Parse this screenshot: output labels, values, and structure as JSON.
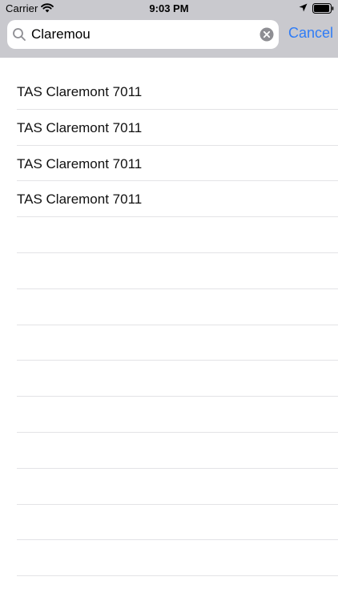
{
  "status_bar": {
    "carrier": "Carrier",
    "time": "9:03 PM"
  },
  "search": {
    "value": "Claremou",
    "cancel_label": "Cancel"
  },
  "results": [
    {
      "label": "TAS Claremont 7011"
    },
    {
      "label": "TAS Claremont 7011"
    },
    {
      "label": "TAS Claremont 7011"
    },
    {
      "label": "TAS Claremont 7011"
    }
  ],
  "empty_rows": 10,
  "colors": {
    "header_bg": "#c9c9ce",
    "accent": "#2f7cf6",
    "separator": "#e3e3e6"
  }
}
